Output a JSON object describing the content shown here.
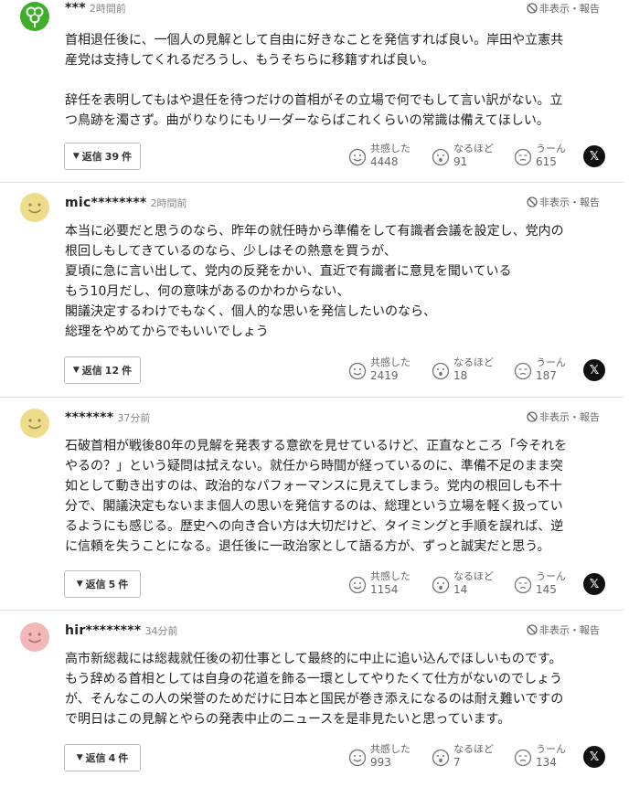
{
  "labels": {
    "report": "非表示・報告",
    "reply_prefix": "返信",
    "reply_suffix": "件",
    "react_empathy": "共感した",
    "react_insight": "なるほど",
    "react_hmm": "うーん",
    "share_x": "𝕏"
  },
  "colors": {
    "avatar_green": "#3fae2a",
    "avatar_yellow": "#efdc8a",
    "avatar_pink": "#f2b8b8"
  },
  "comments": [
    {
      "avatar": "clover-avatar",
      "user": "***",
      "time": "2時間前",
      "lines": [
        "首相退任後に、一個人の見解として自由に好きなことを発信すれば良い。岸田や立憲共",
        "産党は支持してくれるだろうし、もうそちらに移籍すれば良い。",
        "",
        "辞任を表明してもはや退任を待つだけの首相がその立場で何でもして言い訳がない。立",
        "つ鳥跡を濁さず。曲がりなりにもリーダーならばこれくらいの常識は備えてほしい。"
      ],
      "replies": "39",
      "empathy": "4448",
      "insight": "91",
      "hmm": "615"
    },
    {
      "avatar": "smiley-avatar",
      "user": "mic********",
      "time": "2時間前",
      "lines": [
        "本当に必要だと思うのなら、昨年の就任時から準備をして有識者会議を設定し、党内の",
        "根回しもしてきているのなら、少しはその熱意を買うが、",
        "夏頃に急に言い出して、党内の反発をかい、直近で有識者に意見を聞いている",
        "もう10月だし、何の意味があるのかわからない、",
        "閣議決定するわけでもなく、個人的な思いを発信したいのなら、",
        "総理をやめてからでもいいでしょう"
      ],
      "replies": "12",
      "empathy": "2419",
      "insight": "18",
      "hmm": "187"
    },
    {
      "avatar": "smiley-avatar",
      "user": "*******",
      "time": "37分前",
      "lines": [
        "石破首相が戦後80年の見解を発表する意欲を見せているけど、正直なところ「今それを",
        "やるの？」という疑問は拭えない。就任から時間が経っているのに、準備不足のまま突",
        "如として動き出すのは、政治的なパフォーマンスに見えてしまう。党内の根回しも不十",
        "分で、閣議決定もないまま個人の思いを発信するのは、総理という立場を軽く扱ってい",
        "るようにも感じる。歴史への向き合い方は大切だけど、タイミングと手順を誤れば、逆",
        "に信頼を失うことになる。退任後に一政治家として語る方が、ずっと誠実だと思う。"
      ],
      "replies": "5",
      "empathy": "1154",
      "insight": "14",
      "hmm": "145"
    },
    {
      "avatar": "smiley-pink-avatar",
      "user": "hir********",
      "time": "34分前",
      "lines": [
        "高市新総裁には総裁就任後の初仕事として最終的に中止に追い込んでほしいものです。",
        "もう辞める首相としては自身の花道を飾る一環としてやりたくて仕方がないのでしょう",
        "が、そんなこの人の栄誉のためだけに日本と国民が巻き添えになるのは耐え難いですの",
        "で明日はこの見解とやらの発表中止のニュースを是非見たいと思っています。"
      ],
      "replies": "4",
      "empathy": "993",
      "insight": "7",
      "hmm": "134"
    }
  ]
}
